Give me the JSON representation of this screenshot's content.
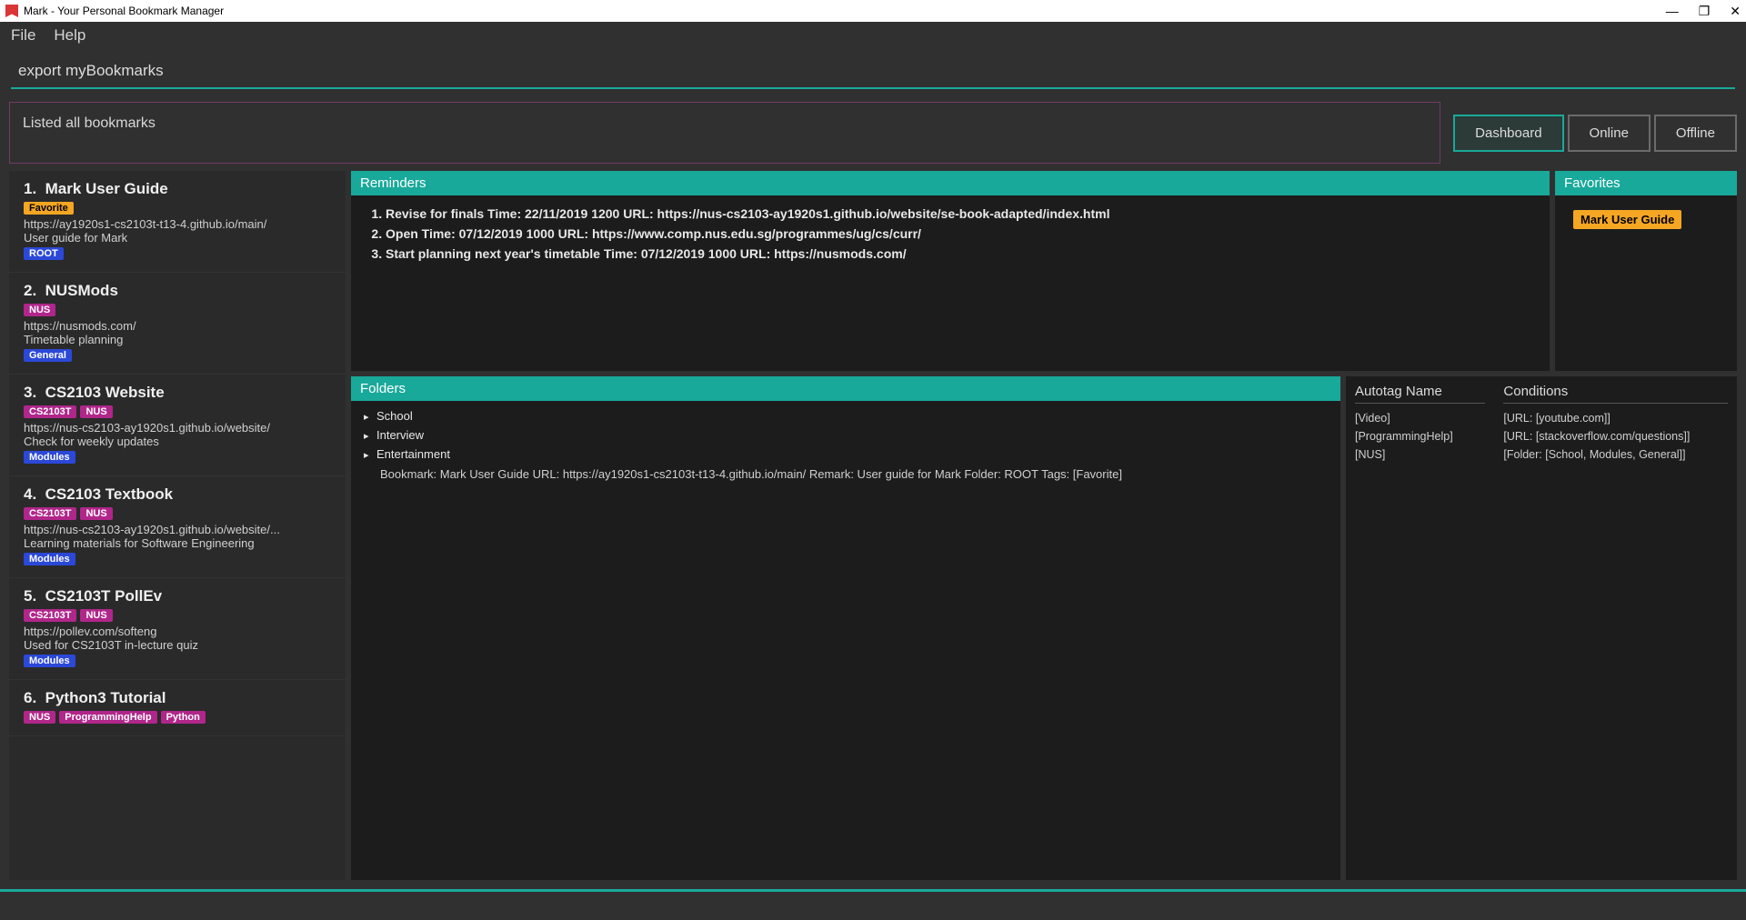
{
  "window": {
    "title": "Mark - Your Personal Bookmark Manager"
  },
  "menu": {
    "file": "File",
    "help": "Help"
  },
  "command_input": "export myBookmarks",
  "status_message": "Listed all bookmarks",
  "tabs": {
    "dashboard": "Dashboard",
    "online": "Online",
    "offline": "Offline"
  },
  "tag_colors": {
    "Favorite": "#f5a623",
    "ROOT": "#2b48d8",
    "NUS": "#b0268a",
    "General": "#2b48d8",
    "CS2103T": "#b0268a",
    "Modules": "#2b48d8",
    "ProgrammingHelp": "#b0268a",
    "Python": "#b0268a"
  },
  "bookmarks": [
    {
      "index": "1.",
      "title": "Mark User Guide",
      "top_tags": [
        "Favorite"
      ],
      "url": "https://ay1920s1-cs2103t-t13-4.github.io/main/",
      "remark": "User guide for Mark",
      "bottom_tags": [
        "ROOT"
      ]
    },
    {
      "index": "2.",
      "title": "NUSMods",
      "top_tags": [
        "NUS"
      ],
      "url": "https://nusmods.com/",
      "remark": "Timetable planning",
      "bottom_tags": [
        "General"
      ]
    },
    {
      "index": "3.",
      "title": "CS2103 Website",
      "top_tags": [
        "CS2103T",
        "NUS"
      ],
      "url": "https://nus-cs2103-ay1920s1.github.io/website/",
      "remark": "Check for weekly updates",
      "bottom_tags": [
        "Modules"
      ]
    },
    {
      "index": "4.",
      "title": "CS2103 Textbook",
      "top_tags": [
        "CS2103T",
        "NUS"
      ],
      "url": "https://nus-cs2103-ay1920s1.github.io/website/...",
      "remark": "Learning materials for Software Engineering",
      "bottom_tags": [
        "Modules"
      ]
    },
    {
      "index": "5.",
      "title": "CS2103T PollEv",
      "top_tags": [
        "CS2103T",
        "NUS"
      ],
      "url": "https://pollev.com/softeng",
      "remark": "Used for CS2103T in-lecture quiz",
      "bottom_tags": [
        "Modules"
      ]
    },
    {
      "index": "6.",
      "title": "Python3 Tutorial",
      "top_tags": [
        "NUS",
        "ProgrammingHelp",
        "Python"
      ],
      "url": "",
      "remark": "",
      "bottom_tags": []
    }
  ],
  "reminders_header": "Reminders",
  "reminders": [
    "Revise for finals Time: 22/11/2019 1200 URL: https://nus-cs2103-ay1920s1.github.io/website/se-book-adapted/index.html",
    "Open Time: 07/12/2019 1000 URL: https://www.comp.nus.edu.sg/programmes/ug/cs/curr/",
    "Start planning next year's timetable Time: 07/12/2019 1000 URL: https://nusmods.com/"
  ],
  "favorites_header": "Favorites",
  "favorites": [
    "Mark User Guide"
  ],
  "folders_header": "Folders",
  "folders": [
    "School",
    "Interview",
    "Entertainment"
  ],
  "bookmark_detail": "Bookmark: Mark User Guide URL: https://ay1920s1-cs2103t-t13-4.github.io/main/ Remark: User guide for Mark Folder: ROOT Tags: [Favorite]",
  "autotag": {
    "name_header": "Autotag Name",
    "cond_header": "Conditions",
    "rows": [
      {
        "name": "[Video]",
        "cond": "[URL: [youtube.com]]"
      },
      {
        "name": "[ProgrammingHelp]",
        "cond": "[URL: [stackoverflow.com/questions]]"
      },
      {
        "name": "[NUS]",
        "cond": "[Folder: [School, Modules, General]]"
      }
    ]
  }
}
